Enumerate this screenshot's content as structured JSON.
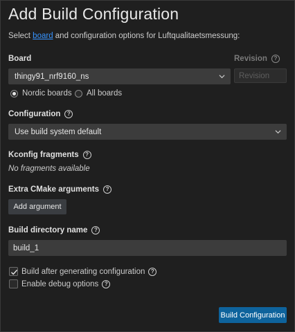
{
  "header": {
    "title": "Add Build Configuration",
    "subtitle_prefix": "Select ",
    "subtitle_link": "board",
    "subtitle_suffix": " and configuration options for Luftqualitaetsmessung:"
  },
  "board": {
    "label": "Board",
    "value": "thingy91_nrf9160_ns",
    "options": [
      {
        "label": "Nordic boards",
        "checked": true
      },
      {
        "label": "All boards",
        "checked": false
      }
    ]
  },
  "revision": {
    "label": "Revision",
    "placeholder": "Revision"
  },
  "configuration": {
    "label": "Configuration",
    "value": "Use build system default"
  },
  "kconfig": {
    "label": "Kconfig fragments",
    "empty_text": "No fragments available"
  },
  "cmake": {
    "label": "Extra CMake arguments",
    "add_label": "Add argument"
  },
  "build_dir": {
    "label": "Build directory name",
    "value": "build_1"
  },
  "checks": [
    {
      "label": "Build after generating configuration",
      "checked": true
    },
    {
      "label": "Enable debug options",
      "checked": false
    }
  ],
  "footer": {
    "submit_label": "Build Configuration"
  },
  "icons": {
    "help": "question-circle-icon",
    "chevron": "chevron-down-icon",
    "check": "checkmark-icon"
  },
  "colors": {
    "background": "#1f1f1f",
    "link": "#3794ff",
    "primary_button": "#0e639c",
    "input_background": "#3c3c3c"
  }
}
